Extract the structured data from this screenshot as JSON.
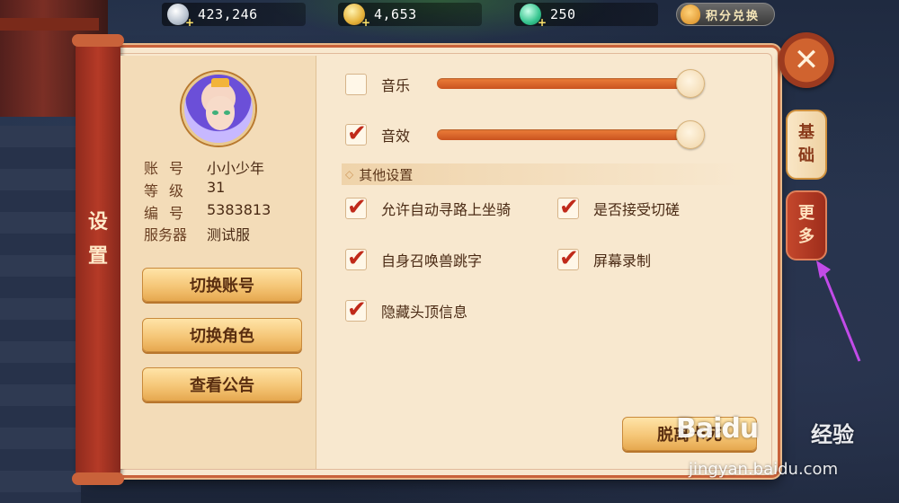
{
  "currencies": [
    {
      "icon": "silver-coin-icon",
      "value": "423,246"
    },
    {
      "icon": "gold-coin-icon",
      "value": "4,653"
    },
    {
      "icon": "jade-coin-icon",
      "value": "250"
    }
  ],
  "redeem": {
    "label": "积分兑换",
    "icon": "lucky-bag-icon"
  },
  "panel": {
    "title_chars": [
      "设",
      "置"
    ]
  },
  "profile": {
    "rows": [
      {
        "key": "账号",
        "value": "小小少年"
      },
      {
        "key": "等级",
        "value": "31"
      },
      {
        "key": "编号",
        "value": "5383813"
      },
      {
        "key": "服务器",
        "value": "测试服"
      }
    ],
    "buttons": [
      "切换账号",
      "切换角色",
      "查看公告"
    ]
  },
  "audio": [
    {
      "label": "音乐",
      "checked": false,
      "volume": 1.0
    },
    {
      "label": "音效",
      "checked": true,
      "volume": 1.0
    }
  ],
  "other": {
    "section_title": "其他设置",
    "options": [
      {
        "label": "允许自动寻路上坐骑",
        "checked": true
      },
      {
        "label": "是否接受切磋",
        "checked": true
      },
      {
        "label": "自身召唤兽跳字",
        "checked": true
      },
      {
        "label": "屏幕录制",
        "checked": true
      },
      {
        "label": "隐藏头顶信息",
        "checked": true
      }
    ]
  },
  "exit_button": "脱离卡死",
  "side_tabs": [
    {
      "chars": [
        "基",
        "础"
      ],
      "active": true
    },
    {
      "chars": [
        "更",
        "多"
      ],
      "active": false
    }
  ],
  "close_icon": "close-icon",
  "watermark": {
    "logo": "Baidu",
    "text": "经验",
    "url": "jingyan.baidu.com"
  },
  "colors": {
    "accent": "#c9623a",
    "check": "#c02a1a",
    "slider": "#e0702f",
    "arrow": "#c24be8"
  }
}
